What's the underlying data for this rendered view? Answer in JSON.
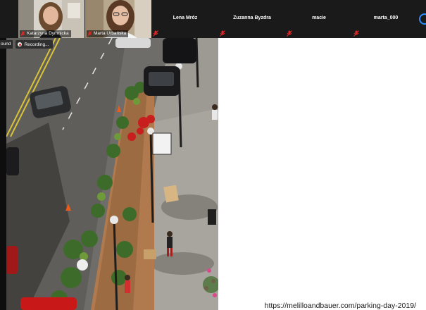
{
  "participants": {
    "video_tiles": [
      {
        "name": "Katarzyna Dymnicka",
        "muted": true
      },
      {
        "name": "Marta Urbańska",
        "muted": true,
        "active_speaker": true
      }
    ],
    "name_tiles": [
      {
        "name": "Lena Mróz",
        "muted": true
      },
      {
        "name": "Zuzanna Byzdra",
        "muted": true
      },
      {
        "name": "macie",
        "muted": true
      },
      {
        "name": "marta_000",
        "muted": true
      }
    ]
  },
  "recording": {
    "sound_label": "ound",
    "status_label": "Recording..."
  },
  "shared_content": {
    "caption_url": "https://melilloandbauer.com/parking-day-2019/"
  },
  "colors": {
    "strip_bg": "#1a1a1a",
    "active_border": "#6ac24a",
    "mic_muted": "#e02828",
    "accent": "#2d8cff"
  }
}
